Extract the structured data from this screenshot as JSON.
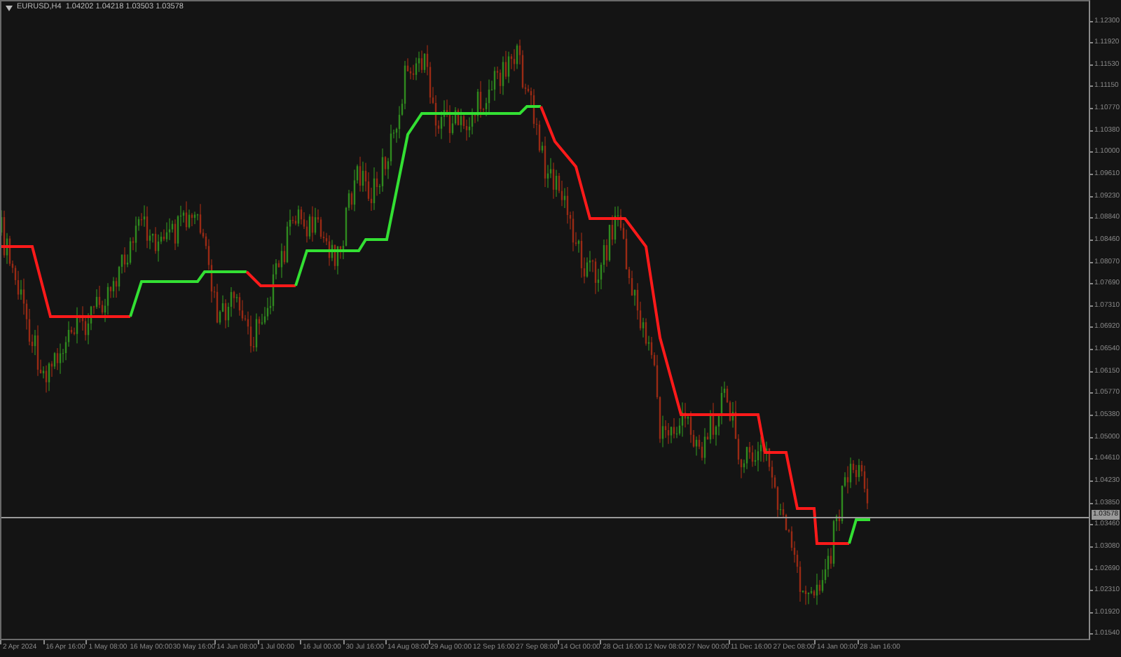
{
  "chart_header": {
    "symbol_info": "EURUSD,H4  1.04202 1.04218 1.03503 1.03578"
  },
  "price_axis": {
    "labels": [
      "1.12300",
      "1.11920",
      "1.11530",
      "1.11150",
      "1.10770",
      "1.10380",
      "1.10000",
      "1.09610",
      "1.09230",
      "1.08840",
      "1.08460",
      "1.08070",
      "1.07690",
      "1.07310",
      "1.06920",
      "1.06540",
      "1.06150",
      "1.05770",
      "1.05380",
      "1.05000",
      "1.04610",
      "1.04230",
      "1.03850",
      "1.03460",
      "1.03080",
      "1.02690",
      "1.02310",
      "1.01920",
      "1.01540"
    ],
    "current_price": "1.03578"
  },
  "time_axis": {
    "labels": [
      "2 Apr 2024",
      "16 Apr 16:00",
      "1 May 08:00",
      "16 May 00:00",
      "30 May 16:00",
      "14 Jun 08:00",
      "1 Jul 00:00",
      "16 Jul 00:00",
      "30 Jul 16:00",
      "14 Aug 08:00",
      "29 Aug 00:00",
      "12 Sep 16:00",
      "27 Sep 08:00",
      "14 Oct 00:00",
      "28 Oct 16:00",
      "12 Nov 08:00",
      "27 Nov 00:00",
      "11 Dec 16:00",
      "27 Dec 08:00",
      "14 Jan 00:00",
      "28 Jan 16:00"
    ]
  }
}
